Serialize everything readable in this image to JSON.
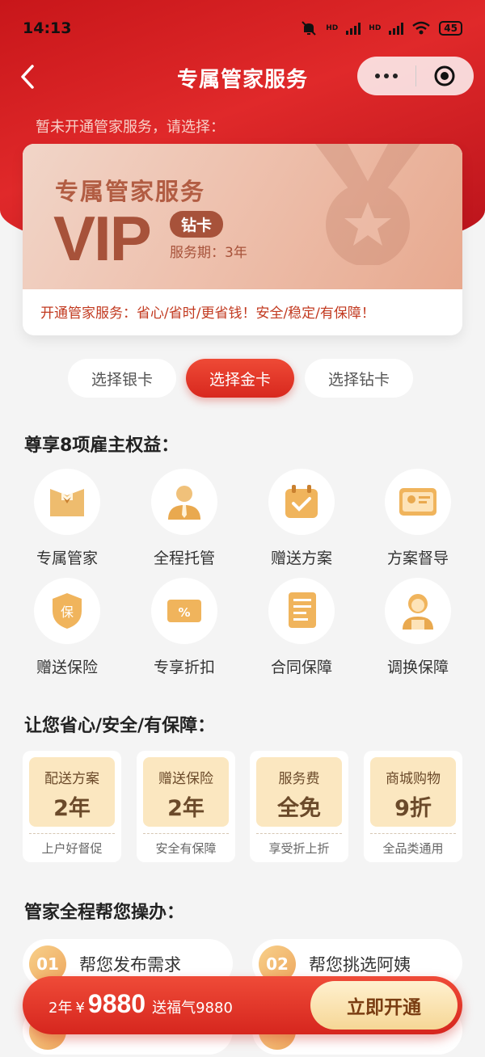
{
  "status_bar": {
    "time": "14:13",
    "hd1": "HD",
    "hd2": "HD",
    "battery": "45"
  },
  "nav": {
    "title": "专属管家服务"
  },
  "hint": "暂未开通管家服务，请选择：",
  "vip_card": {
    "service_name": "专属管家服务",
    "big_text": "VIP",
    "tier": "钻卡",
    "period": "服务期：3年",
    "slogan": "开通管家服务：省心/省时/更省钱！安全/稳定/有保障！"
  },
  "tier_options": [
    {
      "label": "选择银卡",
      "active": false
    },
    {
      "label": "选择金卡",
      "active": true
    },
    {
      "label": "选择钻卡",
      "active": false
    }
  ],
  "benefits": {
    "title": "尊享8项雇主权益：",
    "items": [
      {
        "label": "专属管家",
        "icon": "butler-icon"
      },
      {
        "label": "全程托管",
        "icon": "manager-icon"
      },
      {
        "label": "赠送方案",
        "icon": "calendar-check-icon"
      },
      {
        "label": "方案督导",
        "icon": "id-card-icon"
      },
      {
        "label": "赠送保险",
        "icon": "shield-icon"
      },
      {
        "label": "专享折扣",
        "icon": "discount-ticket-icon"
      },
      {
        "label": "合同保障",
        "icon": "contract-icon"
      },
      {
        "label": "调换保障",
        "icon": "nanny-icon"
      }
    ]
  },
  "assurance": {
    "title": "让您省心/安全/有保障：",
    "items": [
      {
        "key": "配送方案",
        "value": "2年",
        "sub": "上户好督促"
      },
      {
        "key": "赠送保险",
        "value": "2年",
        "sub": "安全有保障"
      },
      {
        "key": "服务费",
        "value": "全免",
        "sub": "享受折上折"
      },
      {
        "key": "商城购物",
        "value": "9折",
        "sub": "全品类通用"
      }
    ]
  },
  "steps": {
    "title": "管家全程帮您操办：",
    "items": [
      {
        "num": "01",
        "text": "帮您发布需求"
      },
      {
        "num": "02",
        "text": "帮您挑选阿姨"
      }
    ]
  },
  "buy_bar": {
    "years": "2年",
    "currency": "¥",
    "amount": "9880",
    "gift": "送福气9880",
    "cta": "立即开通"
  },
  "colors": {
    "primary_red": "#d8281e",
    "gold": "#f6d796",
    "bronze": "#a7523a"
  }
}
